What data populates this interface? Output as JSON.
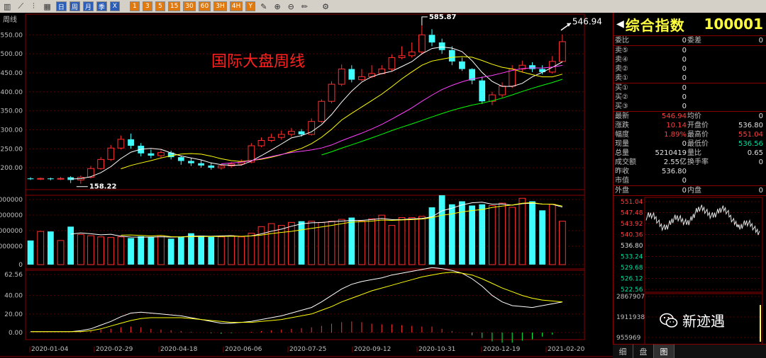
{
  "toolbar": {
    "period_buttons": [
      "日",
      "周",
      "月",
      "季",
      "X"
    ],
    "minute_buttons": [
      "1",
      "3",
      "5",
      "15",
      "30",
      "60",
      "3H",
      "4H",
      "Y"
    ]
  },
  "chart": {
    "period_label": "周线",
    "title_overlay": "国际大盘周线",
    "high_label": "585.87",
    "low_label": "158.22",
    "last_label": "546.94",
    "price_axis": [
      "550.00",
      "500.00",
      "450.00",
      "400.00",
      "350.00",
      "300.00",
      "250.00",
      "200.00"
    ],
    "vol_axis": [
      "0000000",
      "0000000",
      "0000000",
      "0000000",
      "0"
    ],
    "ind_axis": [
      "62.56",
      "40.00",
      "20.00",
      "0.00"
    ],
    "dates": [
      "2020-01-04",
      "2020-02-29",
      "2020-04-18",
      "2020-06-06",
      "2020-07-25",
      "2020-09-12",
      "2020-10-31",
      "2020-12-19",
      "2021-02-20"
    ],
    "colors": {
      "up": "#ff3030",
      "down": "#40ffff",
      "ma5": "#ffffff",
      "ma10": "#ffff00",
      "ma20": "#ff40ff",
      "ma30": "#00ff00"
    }
  },
  "chart_data": {
    "type": "candlestick",
    "candles": [
      [
        172,
        170,
        175,
        168
      ],
      [
        170,
        172,
        174,
        168
      ],
      [
        172,
        170,
        174,
        167
      ],
      [
        170,
        172,
        176,
        168
      ],
      [
        175,
        168,
        178,
        160
      ],
      [
        168,
        175,
        180,
        158
      ],
      [
        175,
        198,
        205,
        172
      ],
      [
        198,
        222,
        228,
        195
      ],
      [
        222,
        252,
        260,
        218
      ],
      [
        252,
        275,
        285,
        248
      ],
      [
        275,
        258,
        290,
        250
      ],
      [
        258,
        238,
        265,
        230
      ],
      [
        238,
        232,
        248,
        225
      ],
      [
        232,
        240,
        246,
        226
      ],
      [
        240,
        228,
        245,
        222
      ],
      [
        228,
        218,
        232,
        208
      ],
      [
        218,
        212,
        226,
        205
      ],
      [
        212,
        206,
        220,
        200
      ],
      [
        206,
        200,
        214,
        195
      ],
      [
        200,
        205,
        210,
        195
      ],
      [
        205,
        210,
        215,
        200
      ],
      [
        210,
        215,
        222,
        206
      ],
      [
        215,
        258,
        265,
        212
      ],
      [
        258,
        272,
        280,
        254
      ],
      [
        272,
        280,
        290,
        268
      ],
      [
        280,
        288,
        298,
        274
      ],
      [
        288,
        296,
        305,
        282
      ],
      [
        296,
        288,
        302,
        282
      ],
      [
        288,
        322,
        330,
        285
      ],
      [
        322,
        375,
        380,
        318
      ],
      [
        375,
        420,
        428,
        370
      ],
      [
        420,
        460,
        472,
        415
      ],
      [
        460,
        432,
        470,
        425
      ],
      [
        432,
        440,
        460,
        428
      ],
      [
        440,
        448,
        470,
        436
      ],
      [
        448,
        460,
        470,
        446
      ],
      [
        460,
        490,
        498,
        455
      ],
      [
        490,
        495,
        520,
        486
      ],
      [
        495,
        505,
        530,
        490
      ],
      [
        505,
        550,
        575,
        498
      ],
      [
        550,
        530,
        565,
        520
      ],
      [
        530,
        510,
        540,
        500
      ],
      [
        510,
        480,
        520,
        470
      ],
      [
        480,
        460,
        490,
        455
      ],
      [
        460,
        430,
        462,
        420
      ],
      [
        430,
        375,
        440,
        368
      ],
      [
        375,
        392,
        400,
        365
      ],
      [
        392,
        415,
        425,
        385
      ],
      [
        415,
        460,
        470,
        410
      ],
      [
        460,
        470,
        482,
        452
      ],
      [
        470,
        460,
        478,
        452
      ],
      [
        460,
        452,
        470,
        446
      ],
      [
        452,
        480,
        494,
        448
      ],
      [
        480,
        532,
        551,
        478
      ]
    ],
    "volumes": [
      40,
      55,
      55,
      40,
      63,
      50,
      48,
      46,
      45,
      46,
      44,
      47,
      46,
      48,
      43,
      46,
      52,
      48,
      46,
      46,
      48,
      46,
      52,
      63,
      68,
      65,
      70,
      72,
      72,
      70,
      72,
      75,
      78,
      72,
      76,
      82,
      65,
      78,
      78,
      80,
      95,
      115,
      100,
      105,
      98,
      100,
      98,
      102,
      95,
      110,
      105,
      90,
      100,
      72
    ],
    "volume_units": "relative",
    "kdj_k": [
      1,
      1,
      1,
      1,
      1,
      2,
      4,
      8,
      12,
      17,
      21,
      22,
      21,
      20,
      19,
      18,
      16,
      14,
      12,
      10,
      10,
      11,
      12,
      14,
      16,
      18,
      21,
      24,
      27,
      33,
      40,
      47,
      52,
      55,
      57,
      59,
      62,
      64,
      66,
      68,
      70,
      69,
      67,
      64,
      58,
      50,
      40,
      33,
      29,
      28,
      27,
      29,
      31,
      33
    ],
    "kdj_d": [
      1,
      1,
      1,
      1,
      1,
      1,
      2,
      4,
      7,
      10,
      13,
      15,
      16,
      16,
      16,
      16,
      15,
      14,
      13,
      12,
      11,
      11,
      11,
      12,
      13,
      14,
      16,
      18,
      20,
      24,
      28,
      33,
      37,
      41,
      45,
      48,
      51,
      54,
      57,
      60,
      62,
      64,
      65,
      64,
      62,
      58,
      53,
      48,
      44,
      40,
      37,
      35,
      34,
      33
    ],
    "kdj_max": 62.56,
    "title": "国际大盘周线",
    "xlabel": "",
    "ylabel": ""
  },
  "panel": {
    "name": "综合指数",
    "code": "100001",
    "ratio": {
      "l1": "委比",
      "v1": "0",
      "l2": "委差",
      "v2": "0"
    },
    "asks": [
      {
        "l": "卖⑤",
        "v": "0"
      },
      {
        "l": "卖④",
        "v": "0"
      },
      {
        "l": "卖②",
        "v": "0"
      },
      {
        "l": "卖①",
        "v": "0"
      }
    ],
    "bids": [
      {
        "l": "买①",
        "v": "0"
      },
      {
        "l": "买②",
        "v": "0"
      },
      {
        "l": "买③",
        "v": "0"
      }
    ],
    "stats": [
      {
        "l1": "最新",
        "v1": "546.94",
        "c1": "red",
        "l2": "均价",
        "v2": "0",
        "c2": "wht"
      },
      {
        "l1": "涨跌",
        "v1": "10.14",
        "c1": "red",
        "l2": "开盘价",
        "v2": "536.80",
        "c2": "wht"
      },
      {
        "l1": "幅度",
        "v1": "1.89%",
        "c1": "red",
        "l2": "最高价",
        "v2": "551.04",
        "c2": "red"
      },
      {
        "l1": "现量",
        "v1": "0",
        "c1": "wht",
        "l2": "最低价",
        "v2": "536.56",
        "c2": "grn"
      },
      {
        "l1": "总量",
        "v1": "5210419",
        "c1": "wht",
        "l2": "量比",
        "v2": "0.65",
        "c2": "wht"
      },
      {
        "l1": "成交额",
        "v1": "2.55亿",
        "c1": "wht",
        "l2": "换手率",
        "v2": "0",
        "c2": "wht"
      },
      {
        "l1": "昨收",
        "v1": "536.80",
        "c1": "wht",
        "l2": "",
        "v2": "",
        "c2": "wht"
      },
      {
        "l1": "市值",
        "v1": "0",
        "c1": "wht",
        "l2": "",
        "v2": "",
        "c2": "wht"
      }
    ],
    "outer": {
      "l1": "外盘",
      "v1": "0",
      "l2": "内盘",
      "v2": "0"
    },
    "mini_price_axis": [
      "551.04",
      "547.48",
      "543.92",
      "540.36",
      "536.80",
      "533.24",
      "529.68",
      "526.12",
      "522.56"
    ],
    "mini_vol_axis": [
      "2867907",
      "1911938",
      "955969"
    ],
    "tabs": [
      "细",
      "盘",
      "图"
    ],
    "watermark": "新迹遇"
  }
}
